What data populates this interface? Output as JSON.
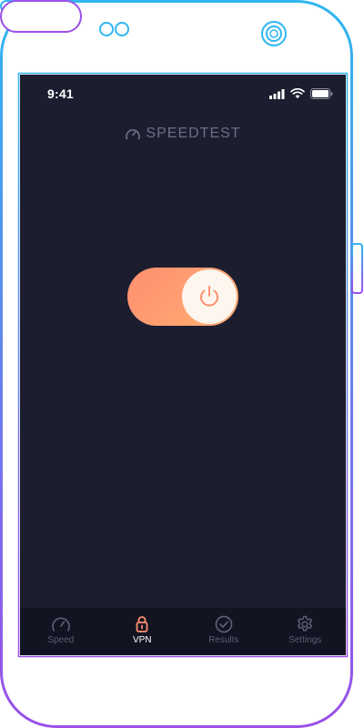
{
  "status_bar": {
    "time": "9:41",
    "icons": [
      "signal-icon",
      "wifi-icon",
      "battery-icon"
    ]
  },
  "header": {
    "brand": "SPEEDTEST",
    "icon": "speedometer-icon"
  },
  "vpn": {
    "toggle_state": "on",
    "icon": "power-icon"
  },
  "tabs": [
    {
      "label": "Speed",
      "icon": "speedometer-icon",
      "active": false
    },
    {
      "label": "VPN",
      "icon": "lock-icon",
      "active": true
    },
    {
      "label": "Results",
      "icon": "check-circle-icon",
      "active": false
    },
    {
      "label": "Settings",
      "icon": "gear-icon",
      "active": false
    }
  ],
  "colors": {
    "screen_bg": "#1c1e30",
    "tab_bar_bg": "#131422",
    "accent_orange": "#ff8f70",
    "accent_light": "#ffae72",
    "inactive": "#5b5e72",
    "frame_cyan": "#2fb6f0",
    "frame_purple": "#9b4fe8"
  }
}
